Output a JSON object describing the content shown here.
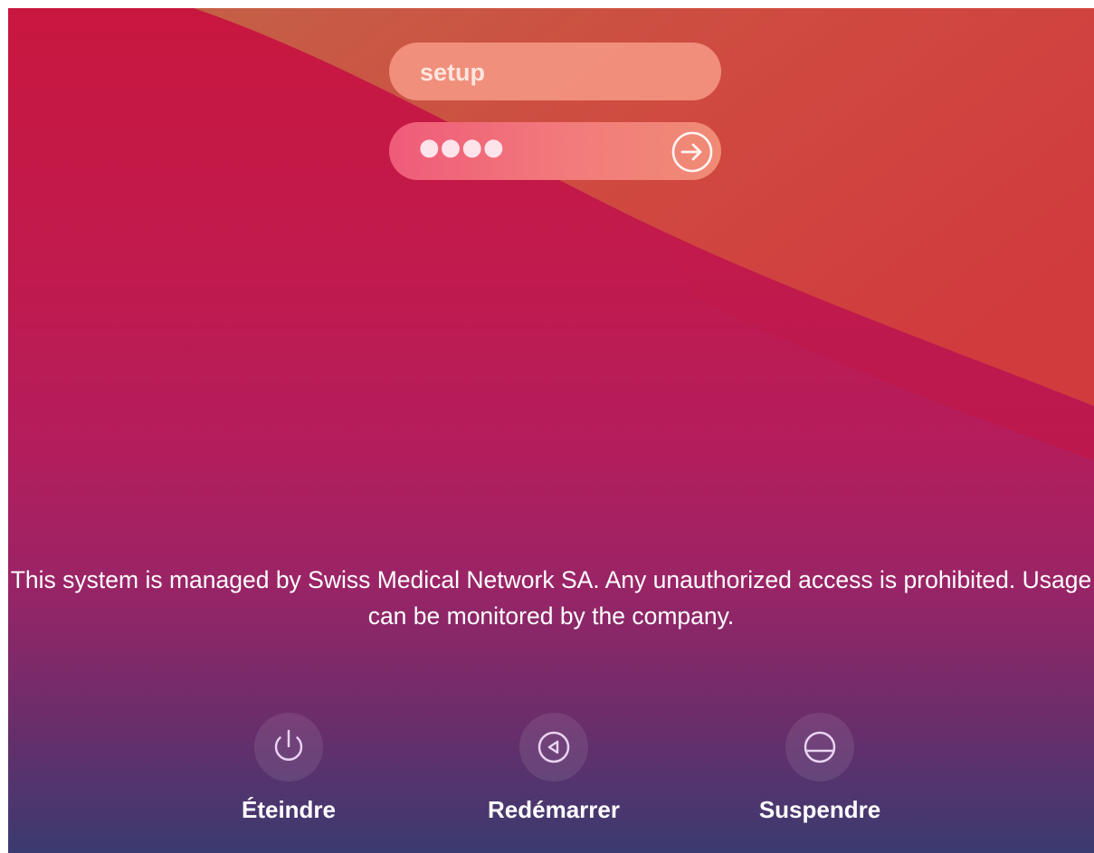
{
  "login": {
    "username": "setup",
    "password_masked": "●●●●"
  },
  "notice": {
    "text": "This system is managed by Swiss Medical Network SA. Any unauthorized access is prohibited. Usage can be monitored by the company."
  },
  "actions": [
    {
      "label": "Éteindre",
      "icon": "power-icon"
    },
    {
      "label": "Redémarrer",
      "icon": "restart-icon"
    },
    {
      "label": "Suspendre",
      "icon": "sleep-icon"
    }
  ],
  "colors": {
    "wallpaper_top": "#c8173f",
    "wallpaper_wave": "#d0473f",
    "wallpaper_bottom": "#3a3b70",
    "username_field": "#f4967f",
    "password_field": "#ef5b7a",
    "text": "#ffffff"
  }
}
